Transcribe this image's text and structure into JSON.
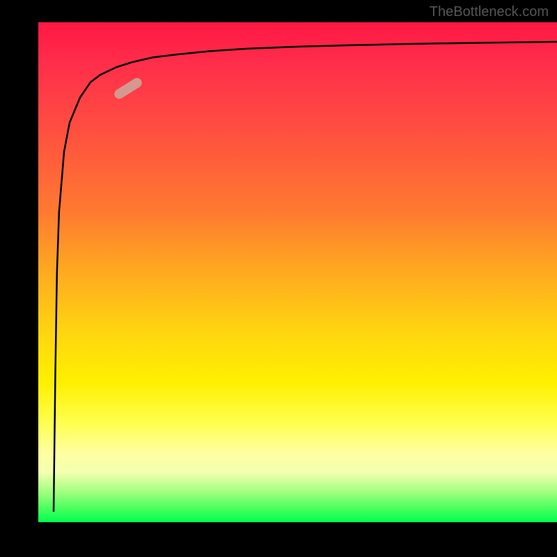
{
  "watermark": "TheBottleneck.com",
  "chart_data": {
    "type": "line",
    "title": "",
    "xlabel": "",
    "ylabel": "",
    "series": [
      {
        "name": "curve",
        "x": [
          0.03,
          0.033,
          0.036,
          0.04,
          0.05,
          0.06,
          0.08,
          0.1,
          0.12,
          0.15,
          0.18,
          0.22,
          0.27,
          0.33,
          0.4,
          0.5,
          0.6,
          0.72,
          0.85,
          1.0
        ],
        "y": [
          0.02,
          0.3,
          0.5,
          0.62,
          0.74,
          0.8,
          0.85,
          0.88,
          0.895,
          0.91,
          0.92,
          0.93,
          0.937,
          0.943,
          0.948,
          0.952,
          0.955,
          0.958,
          0.96,
          0.962
        ]
      }
    ],
    "xlim": [
      0,
      1
    ],
    "ylim": [
      0,
      1
    ],
    "marker_position": {
      "x": 0.175,
      "y": 0.868
    },
    "gradient_colors": {
      "top": "#ff1744",
      "middle": "#fff000",
      "bottom": "#00ff50"
    },
    "axis_color": "#000000",
    "background_color": "#000000"
  }
}
